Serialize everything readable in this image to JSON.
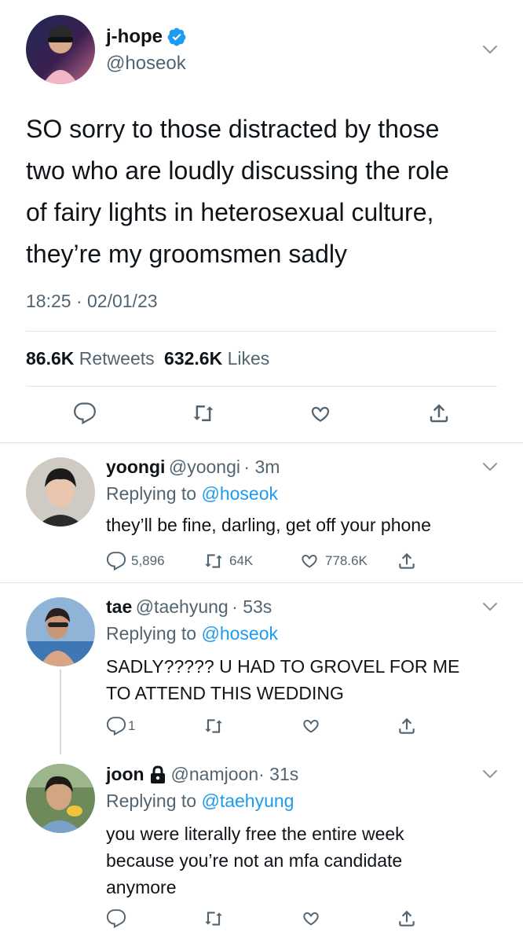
{
  "colors": {
    "accent": "#1d9bf0",
    "muted": "#536471",
    "text": "#0f1419",
    "divider": "#dfe3e6"
  },
  "main": {
    "name": "j-hope",
    "handle": "@hoseok",
    "verified_icon": "verified-badge-icon",
    "text_lines": [
      "SO sorry to those distracted by those",
      "two who are loudly discussing the role",
      "of fairy lights in heterosexual culture,",
      "they’re my groomsmen sadly"
    ],
    "timestamp": "18:25 · 02/01/23",
    "retweets_count": "86.6K",
    "retweets_label": "Retweets",
    "likes_count": "632.6K",
    "likes_label": "Likes"
  },
  "replies": [
    {
      "name": "yoongi",
      "handle": "@yoongi",
      "time": "· 3m",
      "replying_prefix": "Replying to",
      "replying_to": "@hoseok",
      "text_lines": [
        "they’ll be fine, darling, get off your phone"
      ],
      "reply_count": "5,896",
      "retweet_count": "64K",
      "like_count": "778.6K"
    },
    {
      "name": "tae",
      "handle": "@taehyung",
      "time": "· 53s",
      "replying_prefix": "Replying to",
      "replying_to": "@hoseok",
      "text_lines": [
        "SADLY????? U HAD TO GROVEL FOR ME",
        "TO ATTEND THIS WEDDING"
      ],
      "reply_count": "1",
      "retweet_count": "",
      "like_count": ""
    },
    {
      "name": "joon",
      "handle": "@namjoon",
      "time": "· 31s",
      "lock_icon": "lock-icon",
      "replying_prefix": "Replying to",
      "replying_to": "@taehyung",
      "text_lines": [
        "you were literally free the entire week",
        "because you’re not an mfa candidate",
        "anymore"
      ],
      "reply_count": "",
      "retweet_count": "",
      "like_count": ""
    }
  ]
}
